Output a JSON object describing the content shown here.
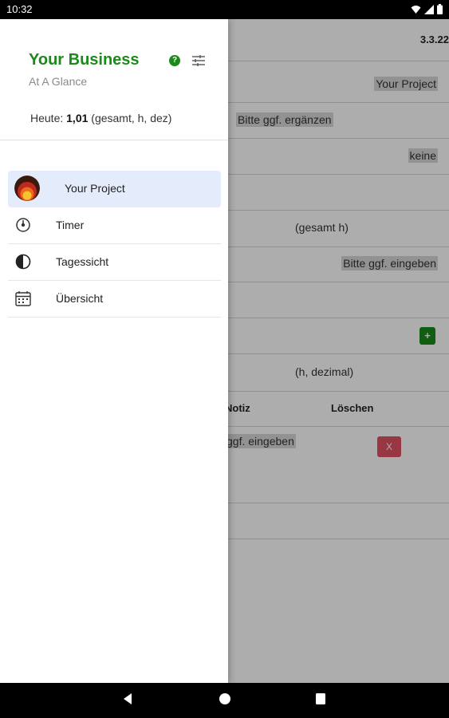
{
  "status_bar": {
    "time": "10:32"
  },
  "background": {
    "version": "3.3.22",
    "project_value": "Your Project",
    "fill_in_hint": "Bitte ggf. ergänzen",
    "none_value": "keine",
    "total_h": "(gesamt h)",
    "enter_hint": "Bitte ggf. eingeben",
    "add_button": "+",
    "hours_decimal": "(h, dezimal)",
    "col_note": "Notiz",
    "col_delete": "Löschen",
    "row_note_hint": "ggf. eingeben",
    "delete_button": "X"
  },
  "drawer": {
    "title": "Your Business",
    "subtitle": "At A Glance",
    "today_prefix": "Heute: ",
    "today_value": "1,01",
    "today_suffix": " (gesamt, h, dez)",
    "items": [
      {
        "label": "Your Project",
        "icon": "project-avatar",
        "active": true
      },
      {
        "label": "Timer",
        "icon": "timer-icon"
      },
      {
        "label": "Tagessicht",
        "icon": "half-circle-icon"
      },
      {
        "label": "Übersicht",
        "icon": "calendar-icon"
      }
    ]
  },
  "colors": {
    "brand_green": "#1b8a1b",
    "active_bg": "#e4ecfb",
    "delete_red": "#e05060"
  }
}
